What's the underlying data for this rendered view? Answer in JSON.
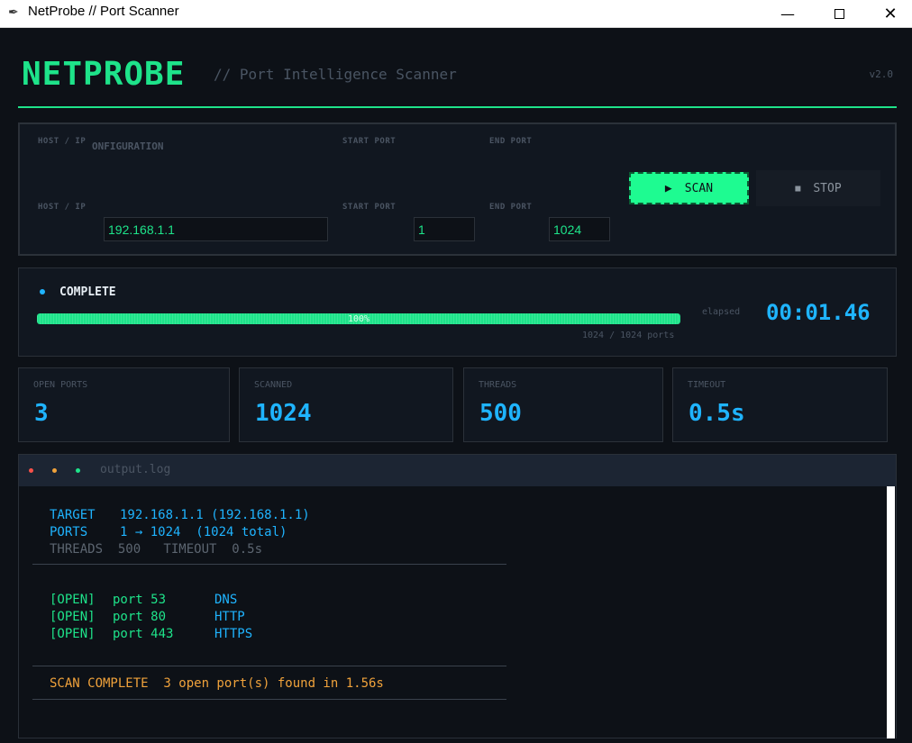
{
  "window": {
    "title": "NetProbe // Port Scanner",
    "icon": "feather-icon"
  },
  "header": {
    "logo": "NETPROBE",
    "subtitle": "// Port Intelligence Scanner",
    "version": "v2.0"
  },
  "config": {
    "title": "ONFIGURATION",
    "host_label": "HOST / IP",
    "start_label": "START PORT",
    "end_label": "END PORT",
    "host_value": "192.168.1.1",
    "start_value": "1",
    "end_value": "1024",
    "scan_label": "SCAN",
    "scan_icon": "▶",
    "stop_label": "STOP",
    "stop_icon": "■"
  },
  "status": {
    "text": "COMPLETE",
    "progress_percent": 100,
    "progress_label": "100%",
    "ports_count": "1024 / 1024 ports",
    "elapsed_label": "elapsed",
    "elapsed_value": "00:01.46"
  },
  "stats": [
    {
      "label": "OPEN PORTS",
      "value": "3"
    },
    {
      "label": "SCANNED",
      "value": "1024"
    },
    {
      "label": "THREADS",
      "value": "500"
    },
    {
      "label": "TIMEOUT",
      "value": "0.5s"
    }
  ],
  "log": {
    "filename": "output.log",
    "target_key": "TARGET",
    "target_val": "192.168.1.1 (192.168.1.1)",
    "ports_key": "PORTS",
    "ports_val": "1 → 1024  (1024 total)",
    "threads_line": "THREADS  500   TIMEOUT  0.5s",
    "open_ports": [
      {
        "tag": "[OPEN]",
        "port": "port 53",
        "service": "DNS"
      },
      {
        "tag": "[OPEN]",
        "port": "port 80",
        "service": "HTTP"
      },
      {
        "tag": "[OPEN]",
        "port": "port 443",
        "service": "HTTPS"
      }
    ],
    "complete_line": "SCAN COMPLETE  3 open port(s) found in 1.56s"
  },
  "colors": {
    "accent_green": "#1ee38a",
    "accent_cyan": "#1fb4ff",
    "accent_orange": "#f0a23b",
    "background": "#0d1117"
  }
}
